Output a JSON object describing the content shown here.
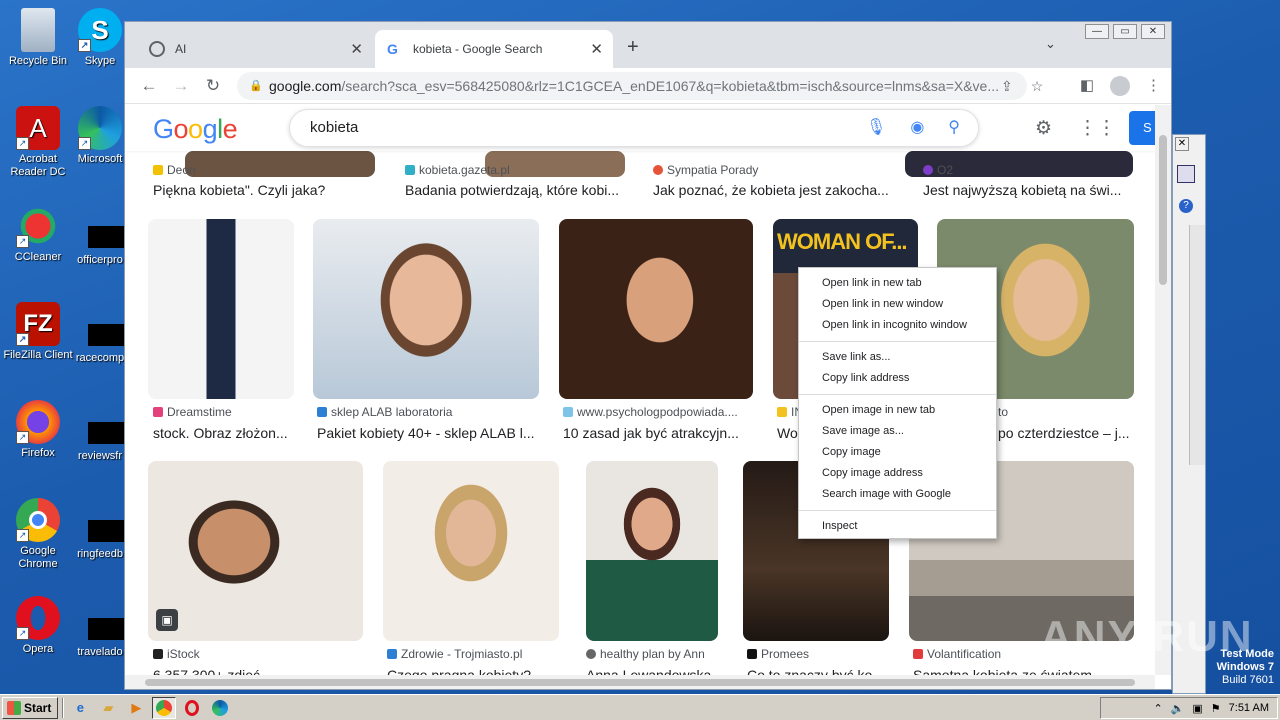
{
  "desktop": {
    "icons": [
      {
        "label": "Recycle Bin",
        "name": "recycle-bin-icon"
      },
      {
        "label": "Skype",
        "name": "skype-icon"
      },
      {
        "label": "Acrobat Reader DC",
        "name": "acrobat-icon"
      },
      {
        "label": "Microsoft",
        "name": "edge-icon"
      },
      {
        "label": "CCleaner",
        "name": "ccleaner-icon"
      },
      {
        "label": "officerpro",
        "name": "file-icon"
      },
      {
        "label": "FileZilla Client",
        "name": "filezilla-icon"
      },
      {
        "label": "racecomp",
        "name": "file-icon"
      },
      {
        "label": "Firefox",
        "name": "firefox-icon"
      },
      {
        "label": "reviewsfr",
        "name": "file-icon"
      },
      {
        "label": "Google Chrome",
        "name": "chrome-icon"
      },
      {
        "label": "ringfeedb",
        "name": "file-icon"
      },
      {
        "label": "Opera",
        "name": "opera-icon"
      },
      {
        "label": "travelado",
        "name": "file-icon"
      }
    ]
  },
  "browser": {
    "tabs": [
      {
        "title": "AI",
        "active": false
      },
      {
        "title": "kobieta - Google Search",
        "active": true
      }
    ],
    "address": {
      "host": "google.com",
      "path": "/search?sca_esv=568425080&rlz=1C1GCEA_enDE1067&q=kobieta&tbm=isch&source=lnms&sa=X&ve..."
    }
  },
  "google": {
    "logo": "Google",
    "query": "kobieta",
    "signin_label": "S"
  },
  "results_top_row": [
    {
      "source": "Deon",
      "title": "Piękna kobieta\". Czyli jaka?"
    },
    {
      "source": "kobieta.gazeta.pl",
      "title": "Badania potwierdzają, które kobi..."
    },
    {
      "source": "Sympatia Porady",
      "title": "Jak poznać, że kobieta jest zakocha..."
    },
    {
      "source": "O2",
      "title": "Jest najwyższą kobietą na świ..."
    }
  ],
  "results_row2": [
    {
      "source": "Dreamstime",
      "title": "stock. Obraz złożon..."
    },
    {
      "source": "sklep ALAB laboratoria",
      "title": "Pakiet kobiety 40+ - sklep ALAB l..."
    },
    {
      "source": "www.psychologpodpowiada....",
      "title": "10 zasad jak być atrakcyjn..."
    },
    {
      "source": "IN",
      "title": "Wor",
      "overlay": "WOMAN OF..."
    },
    {
      "source": "to",
      "title": "po czterdziestce – j..."
    }
  ],
  "results_row3": [
    {
      "source": "iStock",
      "title": "6 357 300+ zdjęć..."
    },
    {
      "source": "Zdrowie - Trojmiasto.pl",
      "title": "Czego pragną kobiety?"
    },
    {
      "source": "healthy plan by Ann",
      "title": "Anna Lewandowska"
    },
    {
      "source": "Promees",
      "title": "Co to znaczy być ko..."
    },
    {
      "source": "Volantification",
      "title": "Samotna kobieta ze światem..."
    }
  ],
  "context_menu": {
    "group1": [
      "Open link in new tab",
      "Open link in new window",
      "Open link in incognito window"
    ],
    "group2": [
      "Save link as...",
      "Copy link address"
    ],
    "group3": [
      "Open image in new tab",
      "Save image as...",
      "Copy image",
      "Copy image address",
      "Search image with Google"
    ],
    "group4": [
      "Inspect"
    ]
  },
  "taskbar": {
    "start_label": "Start",
    "clock": "7:51 AM"
  },
  "watermark": {
    "line1": "Test Mode",
    "line2": "Windows 7",
    "line3": "Build 7601",
    "brand": "ANY RUN"
  }
}
